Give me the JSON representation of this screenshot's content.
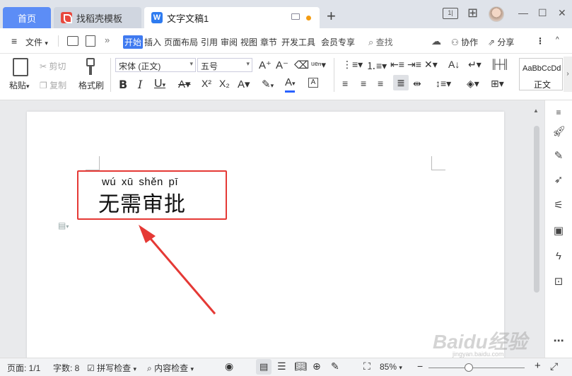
{
  "tabs": {
    "home": "首页",
    "template": "找稻壳模板",
    "document": "文字文稿1",
    "add": "+"
  },
  "window": {
    "layout": "1|",
    "grid": "⊞",
    "minimize": "—",
    "maximize": "☐",
    "close": "✕"
  },
  "menu": {
    "file": "文件",
    "more": "»",
    "items": [
      "开始",
      "插入",
      "页面布局",
      "引用",
      "审阅",
      "视图",
      "章节",
      "开发工具",
      "会员专享"
    ],
    "search": "查找",
    "collab": "协作",
    "share": "分享",
    "kebab": "⋮",
    "collapse": "^"
  },
  "ribbon": {
    "paste": "粘贴",
    "cut": "剪切",
    "copy": "复制",
    "format_painter": "格式刷",
    "font_name": "宋体 (正文)",
    "font_size": "五号",
    "bold": "B",
    "italic": "I",
    "underline": "U",
    "superscript": "X²",
    "subscript": "X₂",
    "style_preview": "AaBbCcDd",
    "style_name": "正文",
    "font_color_accent": "#2962ff"
  },
  "document": {
    "pinyin": "wú  xū  shěn  pī",
    "text": "无需审批",
    "annotation_color": "#e53935"
  },
  "statusbar": {
    "page": "页面: 1/1",
    "word_count": "字数: 8",
    "spell_check": "拼写检查",
    "content_check": "内容检查",
    "zoom": "85%",
    "zoom_out": "−",
    "zoom_in": "+"
  },
  "watermark": {
    "brand": "Baidu经验",
    "url": "jingyan.baidu.com"
  }
}
